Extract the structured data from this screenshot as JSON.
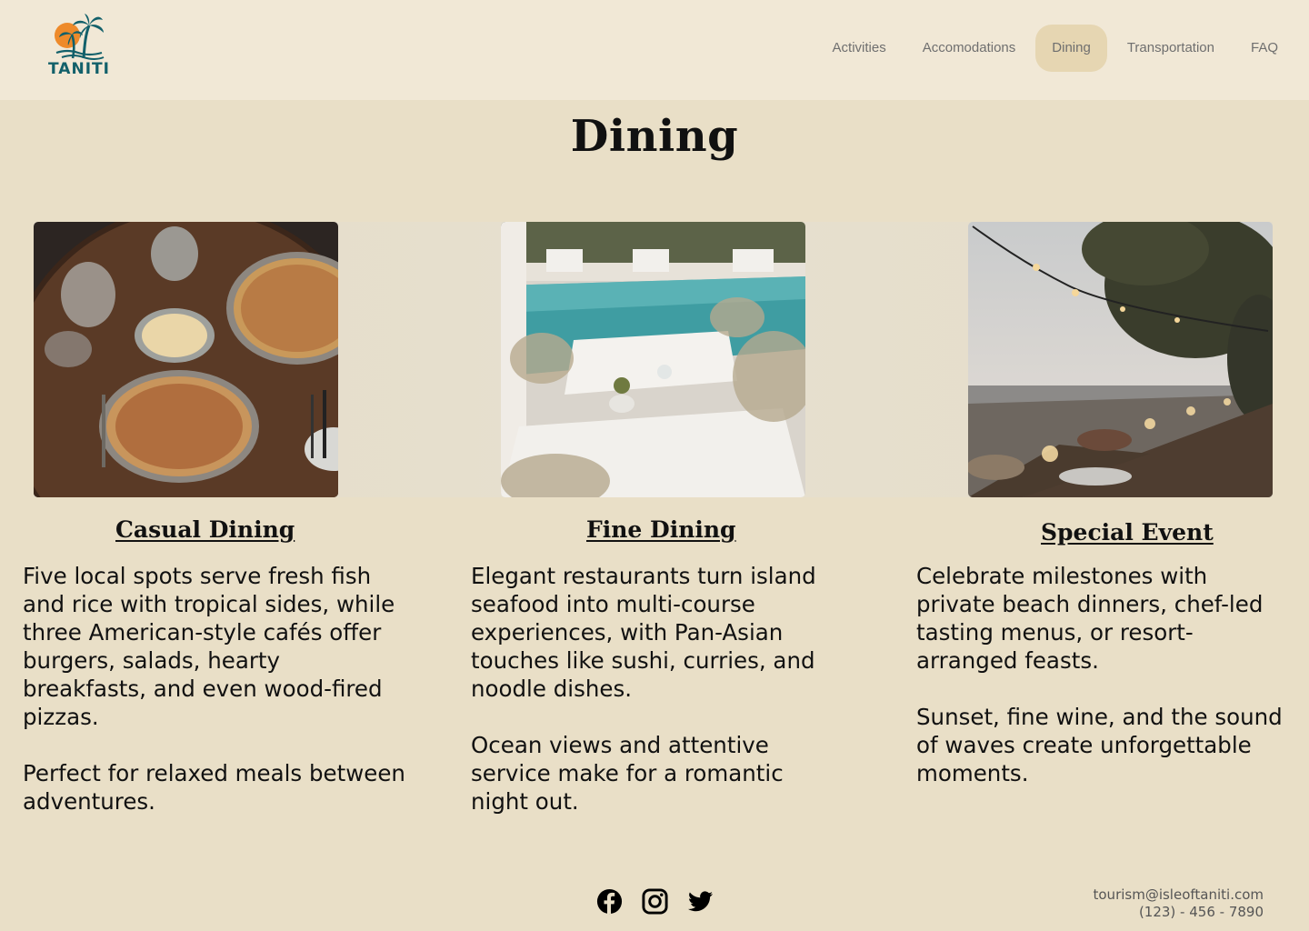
{
  "brand": {
    "name": "TANITI",
    "logo_icon": "palm-tree-sunset-logo"
  },
  "nav": {
    "items": [
      {
        "label": "Activities",
        "active": false
      },
      {
        "label": "Accomodations",
        "active": false
      },
      {
        "label": "Dining",
        "active": true
      },
      {
        "label": "Transportation",
        "active": false
      },
      {
        "label": "FAQ",
        "active": false
      }
    ]
  },
  "page": {
    "title": "Dining"
  },
  "cards": [
    {
      "title": "Casual Dining",
      "image": "pizza-table-photo",
      "paragraphs": [
        "Five local spots serve fresh fish and rice with tropical sides, while three American-style cafés offer burgers, salads, hearty breakfasts, and even wood-fired pizzas.",
        "Perfect for relaxed meals between adventures."
      ]
    },
    {
      "title": "Fine Dining",
      "image": "poolside-restaurant-photo",
      "paragraphs": [
        "Elegant restaurants turn island seafood into multi-course experiences, with Pan-Asian touches like sushi, curries, and noodle dishes.",
        "Ocean views and attentive service make for a romantic night out."
      ]
    },
    {
      "title": "Special Event",
      "image": "beach-dinner-photo",
      "paragraphs": [
        "Celebrate milestones with private beach dinners, chef-led tasting menus, or resort-arranged feasts.",
        "Sunset, fine wine, and the sound of waves create unforgettable moments."
      ]
    }
  ],
  "footer": {
    "social": [
      "facebook-icon",
      "instagram-icon",
      "twitter-icon"
    ],
    "email": "tourism@isleoftaniti.com",
    "phone": "(123) - 456 - 7890"
  },
  "colors": {
    "background": "#e9dfc7",
    "header": "#f1e8d6",
    "nav_active": "#e6d6b2",
    "logo_teal": "#12606a",
    "logo_orange": "#ee8a2a"
  }
}
